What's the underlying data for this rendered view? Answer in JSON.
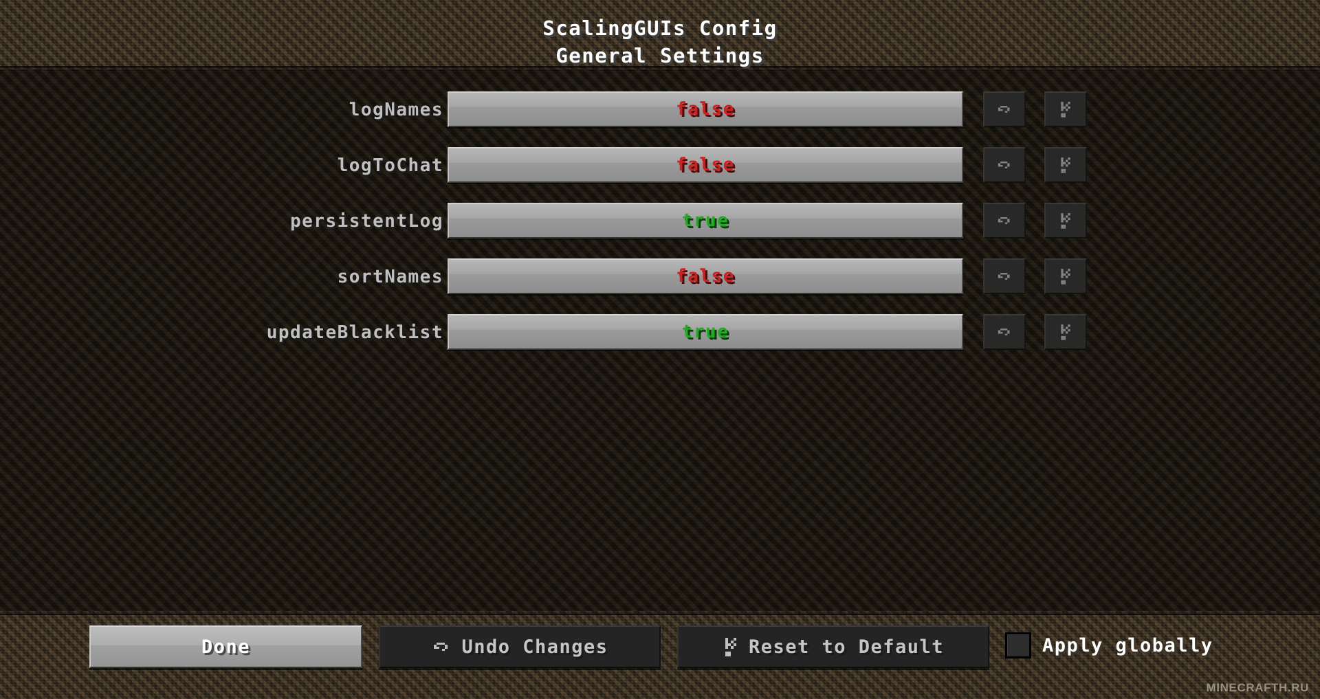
{
  "window": {
    "title_line1": "ScalingGUIs Config",
    "title_line2": "General Settings"
  },
  "colors": {
    "value_true": "#22AA22",
    "value_false": "#CC2222",
    "label_text": "#C0C0C0",
    "title_text": "#FFFFFF",
    "button_face": "#A6A6A6",
    "panel_bg": "#16130E",
    "dirt_bg": "#3A2E20"
  },
  "options": [
    {
      "label": "logNames",
      "value": "false",
      "value_state": "false",
      "undo_icon": "undo-arrow-icon",
      "reset_icon": "reset-default-icon"
    },
    {
      "label": "logToChat",
      "value": "false",
      "value_state": "false",
      "undo_icon": "undo-arrow-icon",
      "reset_icon": "reset-default-icon"
    },
    {
      "label": "persistentLog",
      "value": "true",
      "value_state": "true",
      "undo_icon": "undo-arrow-icon",
      "reset_icon": "reset-default-icon"
    },
    {
      "label": "sortNames",
      "value": "false",
      "value_state": "false",
      "undo_icon": "undo-arrow-icon",
      "reset_icon": "reset-default-icon"
    },
    {
      "label": "updateBlacklist",
      "value": "true",
      "value_state": "true",
      "undo_icon": "undo-arrow-icon",
      "reset_icon": "reset-default-icon"
    }
  ],
  "footer": {
    "done_label": "Done",
    "undo_label": "Undo Changes",
    "undo_icon": "undo-arrow-icon",
    "reset_label": "Reset to Default",
    "reset_icon": "reset-default-icon",
    "apply_globally_label": "Apply globally",
    "apply_globally_checked": false
  },
  "watermark": "MINECRAFTH.RU"
}
